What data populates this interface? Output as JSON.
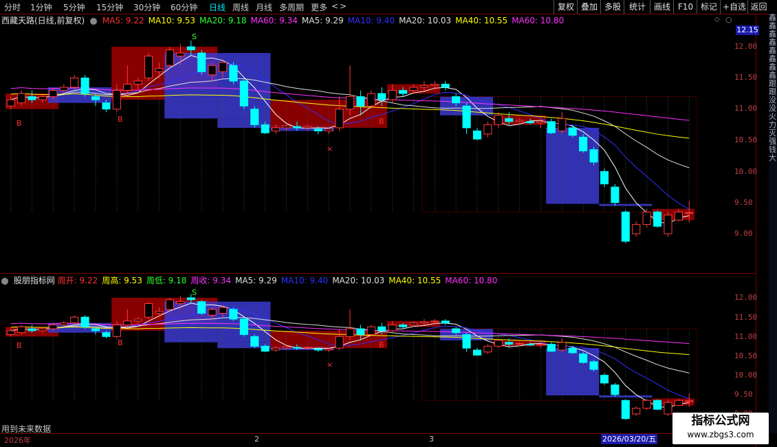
{
  "toolbar": {
    "timeframes": [
      "分时",
      "1分钟",
      "5分钟",
      "15分钟",
      "30分钟",
      "60分钟",
      "日线",
      "周线",
      "月线",
      "多周期",
      "更多"
    ],
    "active_index": 6,
    "arrow_left": "<",
    "arrow_right": ">",
    "right_buttons": [
      "复权",
      "叠加",
      "多股",
      "统计",
      "画线",
      "F10",
      "标记",
      "+自选",
      "返回"
    ]
  },
  "main_panel": {
    "title": "西藏天路(日线,前复权)",
    "indicators": [
      {
        "label": "MA5: 9.22",
        "color": "#ff3030"
      },
      {
        "label": "MA10: 9.53",
        "color": "#ffff00"
      },
      {
        "label": "MA20: 9.18",
        "color": "#30ff30"
      },
      {
        "label": "MA60: 9.34",
        "color": "#ff30ff"
      },
      {
        "label": "MA5: 9.29",
        "color": "#e0e0e0"
      },
      {
        "label": "MA10: 9.40",
        "color": "#3030ff"
      },
      {
        "label": "MA20: 10.03",
        "color": "#e0e0e0"
      },
      {
        "label": "MA40: 10.55",
        "color": "#ffff00"
      },
      {
        "label": "MA60: 10.80",
        "color": "#ff30ff"
      }
    ],
    "price_labels": [
      "12.00",
      "11.50",
      "11.00",
      "10.50",
      "10.00",
      "9.50",
      "9.00"
    ],
    "current_price": "12.15",
    "signal_S": "S",
    "signal_B": "B",
    "signal_X": "×"
  },
  "sub_panel": {
    "title": "股朋指标网",
    "indicators": [
      {
        "label": "周开: 9.22",
        "color": "#ff3030"
      },
      {
        "label": "周高: 9.53",
        "color": "#ffff00"
      },
      {
        "label": "周低: 9.18",
        "color": "#30ff30"
      },
      {
        "label": "周收: 9.34",
        "color": "#ff30ff"
      },
      {
        "label": "MA5: 9.29",
        "color": "#e0e0e0"
      },
      {
        "label": "MA10: 9.40",
        "color": "#3030ff"
      },
      {
        "label": "MA20: 10.03",
        "color": "#e0e0e0"
      },
      {
        "label": "MA40: 10.55",
        "color": "#ffff00"
      },
      {
        "label": "MA60: 10.80",
        "color": "#ff30ff"
      }
    ],
    "price_labels": [
      "12.00",
      "11.50",
      "11.00",
      "10.50",
      "10.00",
      "9.50",
      "9.00"
    ],
    "footer_note": "用到未来数据"
  },
  "date_axis": {
    "year_label": "2026年",
    "month_2": "2",
    "month_3": "3",
    "current_date": "2026/03/20/五"
  },
  "watermark": {
    "title": "指标公式网",
    "url": "www.zbgs3.com"
  },
  "right_strip_text": "鑫鑫鑫鑫鑫鑫鑫鑫跟跟没没火力灭强钱大",
  "colors": {
    "up": "#ff3b3b",
    "down": "#00ffff",
    "bg": "#000000",
    "axis": "#7a0000"
  }
}
